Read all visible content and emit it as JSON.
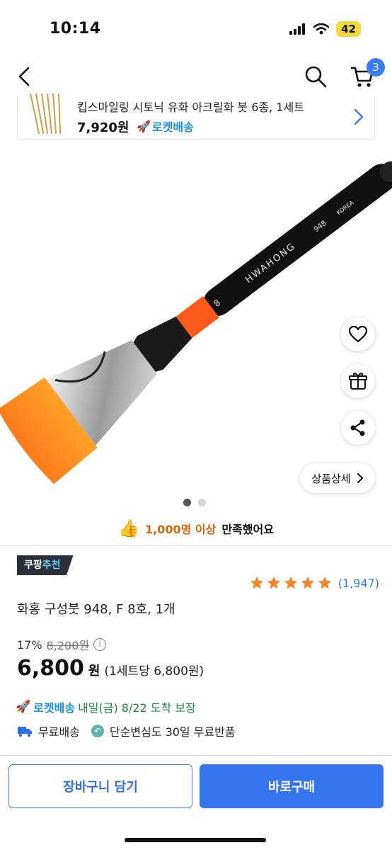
{
  "status_bar": {
    "time": "10:14",
    "battery": "42"
  },
  "nav": {
    "cart_count": "3"
  },
  "bundle": {
    "title": "킵스마일링 시토닉 유화 아크릴화 붓 6종, 1세트",
    "price": "7,920원",
    "delivery": "로켓배송"
  },
  "gallery": {
    "detail_label": "상품상세",
    "slide_current": 1,
    "slide_total": 2
  },
  "satisfaction": {
    "highlight": "1,000명 이상",
    "rest": "만족했어요"
  },
  "recommendation": {
    "brand": "쿠팡",
    "label": "추천"
  },
  "rating": {
    "stars": 5,
    "count": "(1,947)"
  },
  "product": {
    "title": "화홍 구성붓 948, F 8호, 1개",
    "discount": "17%",
    "original_price": "8,200원",
    "price": "6,800",
    "price_unit": "원",
    "unit_price": "(1세트당 6,800원)"
  },
  "delivery": {
    "rocket_label": "로켓배송",
    "eta": "내일(금) 8/22 도착 보장",
    "free_shipping": "무료배송",
    "free_return": "단순변심도 30일 무료반품"
  },
  "actions": {
    "add_to_cart": "장바구니 담기",
    "buy_now": "바로구매"
  },
  "brush_labels": {
    "brand": "HWAHONG",
    "model": "948",
    "origin": "KOREA",
    "size": "8"
  },
  "colors": {
    "accent": "#3474f0",
    "rocket": "#1a8ee0",
    "highlight": "#d2690a",
    "star": "#f5862b"
  }
}
